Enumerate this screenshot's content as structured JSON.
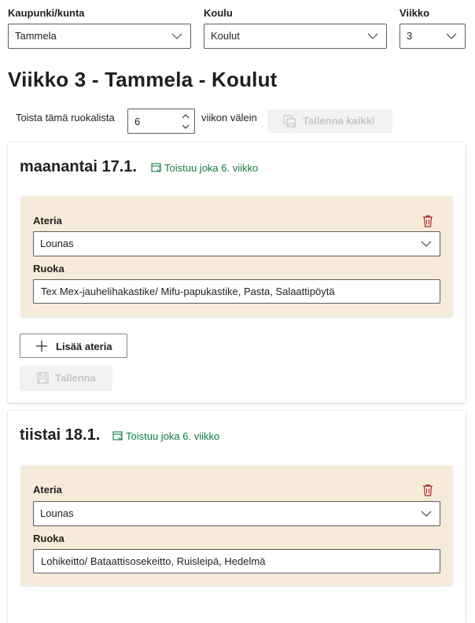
{
  "filters": {
    "city": {
      "label": "Kaupunki/kunta",
      "value": "Tammela"
    },
    "school": {
      "label": "Koulu",
      "value": "Koulut"
    },
    "week": {
      "label": "Viikko",
      "value": "3"
    }
  },
  "page_title": "Viikko 3 - Tammela - Koulut",
  "repeat": {
    "prefix": "Toista tämä ruokalista",
    "interval_value": "6",
    "suffix": "viikon välein",
    "save_all_label": "Tallenna kaikki"
  },
  "days": [
    {
      "title": "maanantai 17.1.",
      "recurrence": "Toistuu joka 6. viikko",
      "meal": {
        "meal_label": "Ateria",
        "meal_value": "Lounas",
        "food_label": "Ruoka",
        "food_value": "Tex Mex-jauhelihakastike/  Mifu-papukastike, Pasta, Salaattipöytä"
      },
      "add_meal_label": "Lisää ateria",
      "save_label": "Tallenna"
    },
    {
      "title": "tiistai 18.1.",
      "recurrence": "Toistuu joka 6. viikko",
      "meal": {
        "meal_label": "Ateria",
        "meal_value": "Lounas",
        "food_label": "Ruoka",
        "food_value": "Lohikeitto/ Bataattisosekeitto, Ruisleipä, Hedelmä"
      }
    }
  ],
  "icons": {
    "chevron": "chevron-down-icon",
    "recurrence": "calendar-repeat-icon",
    "delete": "trash-icon",
    "add": "plus-icon",
    "save": "save-icon",
    "save_all": "save-all-icon"
  },
  "colors": {
    "accent_green": "#107c41",
    "delete_red": "#a4262c",
    "meal_bg": "#f6ebd9",
    "disabled_text": "#c8c6c4",
    "disabled_bg": "#f3f2f1"
  }
}
